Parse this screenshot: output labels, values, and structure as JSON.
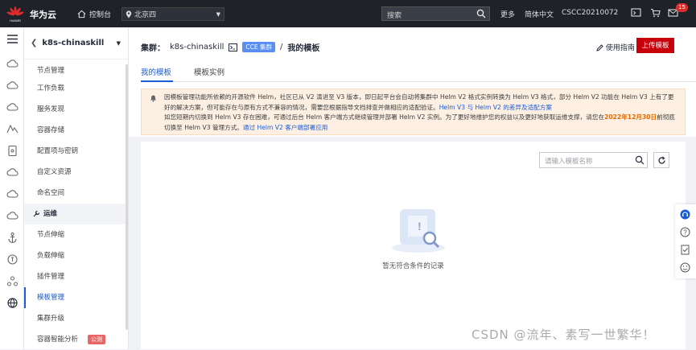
{
  "topbar": {
    "brand_small": "HUAWEI",
    "brand": "华为云",
    "console": "控制台",
    "region": "北京四",
    "search_placeholder": "搜索",
    "more": "更多",
    "lang": "简体中文",
    "account": "CSCC20210072",
    "cart_badge": "15"
  },
  "sidebar": {
    "cluster_name": "k8s-chinaskill",
    "items": [
      {
        "label": "节点管理"
      },
      {
        "label": "工作负载"
      },
      {
        "label": "服务发现"
      },
      {
        "label": "容器存储"
      },
      {
        "label": "配置项与密钥"
      },
      {
        "label": "自定义资源"
      },
      {
        "label": "命名空间"
      },
      {
        "label": "运维"
      },
      {
        "label": "节点伸缩"
      },
      {
        "label": "负载伸缩"
      },
      {
        "label": "插件管理"
      },
      {
        "label": "模板管理"
      },
      {
        "label": "集群升级"
      },
      {
        "label": "容器智能分析",
        "tag": "公测"
      }
    ]
  },
  "header": {
    "cluster_label": "集群：",
    "cluster_name": "k8s-chinaskill",
    "cce_tag": "CCE 集群",
    "sep": "/",
    "page_title": "我的模板",
    "guide": "使用指南",
    "upload": "上传模板"
  },
  "tabs": [
    "我的模板",
    "模板实例"
  ],
  "notice": {
    "text1": "因模板管理功能所依赖的开源软件 Helm，社区已从 V2 演进至 V3 版本，即日起平台会自动将集群中 Helm V2 格式实例转换为 Helm V3 格式，部分 Helm V2 功能在 Helm V3 上有了更好的解决方案，但可能存在与原有方式不兼容的情况，需要您根据指导文档排查并做相应的适配验证。",
    "link1": "Helm V3 与 Helm V2 的差异及适配方案",
    "text2": "如您短期内切换到 Helm V3 存在困难，可通过后台 Helm 客户端方式继续管理并部署 Helm V2 实例。为了更好地维护您的权益以及更好地获取运维支撑，请您在",
    "date": "2022年12月30日",
    "text3": "前彻底切换至 Helm V3 管理方式。",
    "link2": "通过 Helm V2 客户端部署应用"
  },
  "panel": {
    "search_placeholder": "请输入模板名称",
    "empty_text": "暂无符合条件的记录"
  },
  "watermark": "CSDN @流年、素写一世繁华！",
  "colors": {
    "accent": "#1a5bd6",
    "brand_red": "#c7000b",
    "topbar": "#1f2329",
    "notice_bg": "#fdf0e3"
  }
}
